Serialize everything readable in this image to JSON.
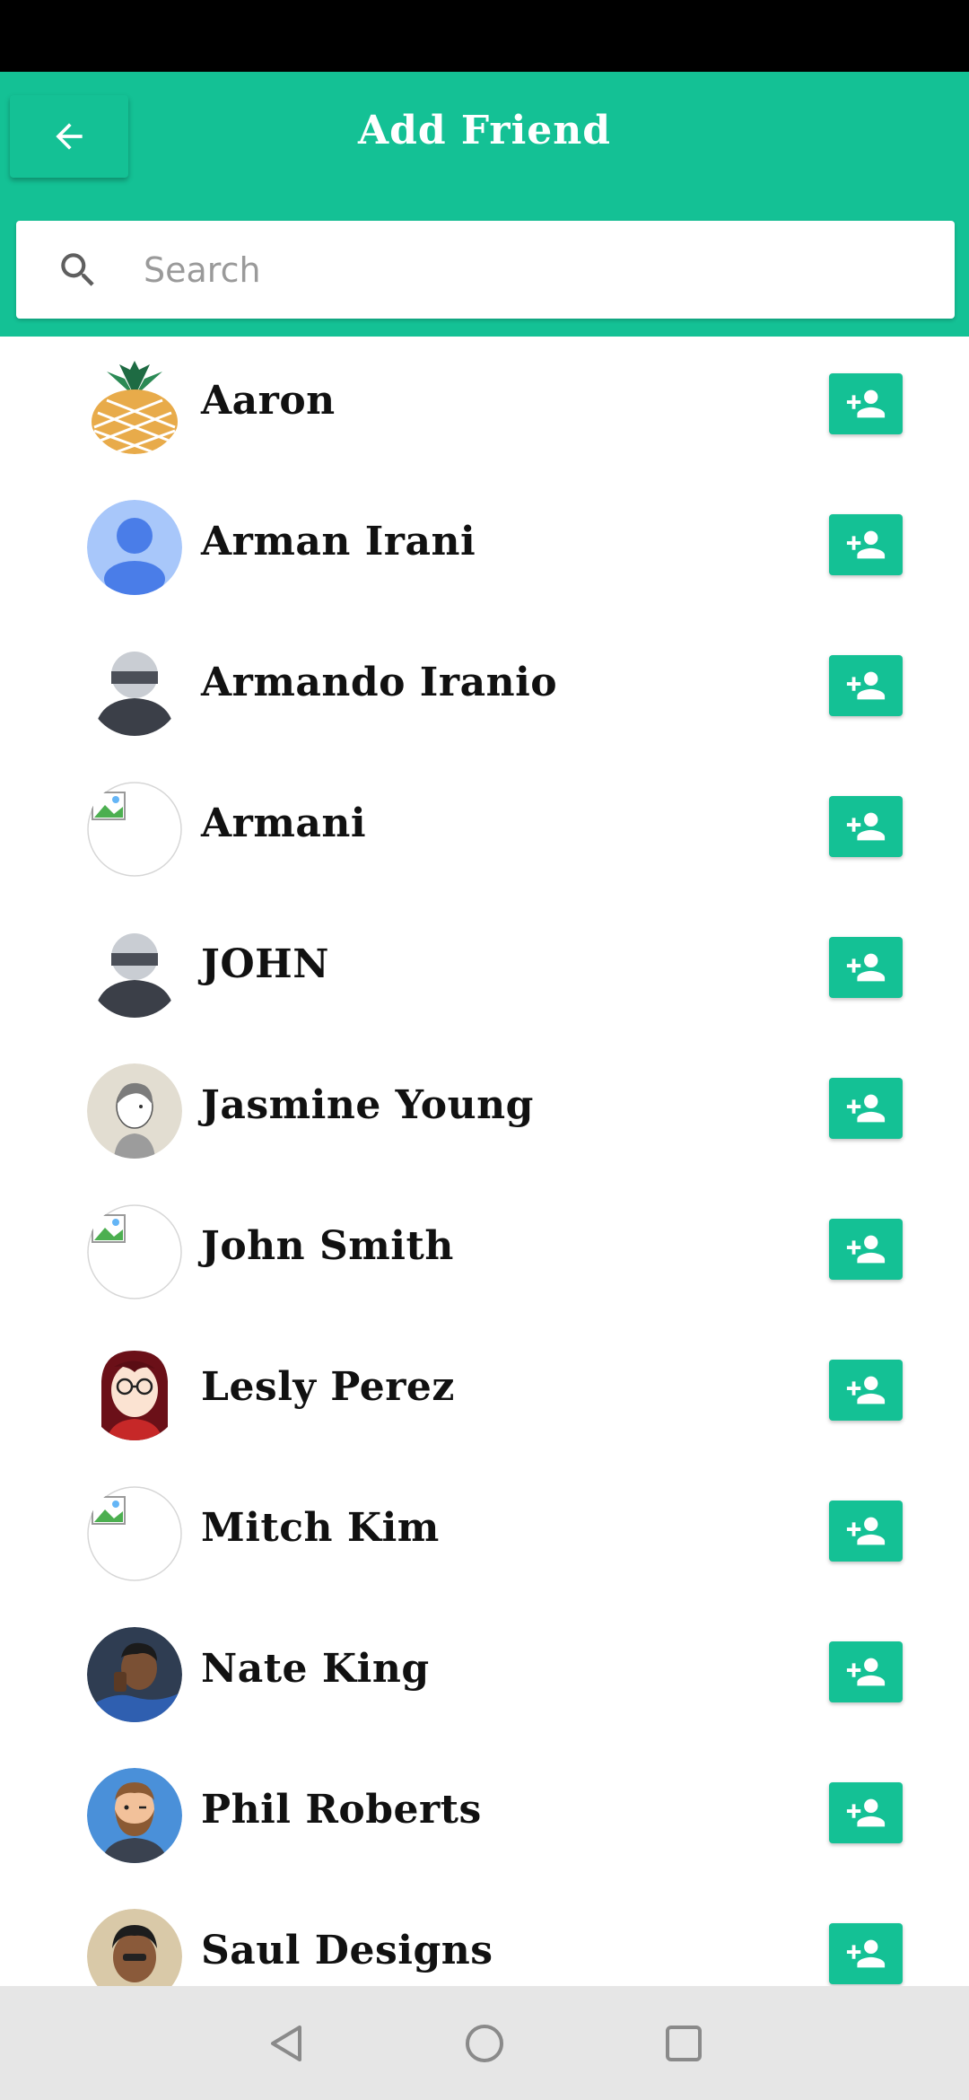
{
  "header": {
    "title": "Add Friend",
    "back_icon": "arrow-left-icon"
  },
  "search": {
    "placeholder": "Search",
    "value": "",
    "icon": "search-icon"
  },
  "colors": {
    "accent": "#14c195",
    "status_bar": "#000000",
    "nav_bar": "#e6e6e6"
  },
  "friends": [
    {
      "name": "Aaron",
      "avatar": "pineapple-avatar",
      "action_icon": "person-add-icon"
    },
    {
      "name": "Arman Irani",
      "avatar": "default-blue-avatar",
      "action_icon": "person-add-icon"
    },
    {
      "name": "Armando Iranio",
      "avatar": "helmet-avatar",
      "action_icon": "person-add-icon"
    },
    {
      "name": "Armani",
      "avatar": "broken-image-avatar",
      "action_icon": "person-add-icon"
    },
    {
      "name": "JOHN",
      "avatar": "helmet-avatar",
      "action_icon": "person-add-icon"
    },
    {
      "name": "Jasmine Young",
      "avatar": "sketch-girl-avatar",
      "action_icon": "person-add-icon"
    },
    {
      "name": "John Smith",
      "avatar": "broken-image-avatar",
      "action_icon": "person-add-icon"
    },
    {
      "name": "Lesly Perez",
      "avatar": "glasses-woman-avatar",
      "action_icon": "person-add-icon"
    },
    {
      "name": "Mitch Kim",
      "avatar": "broken-image-avatar",
      "action_icon": "person-add-icon"
    },
    {
      "name": "Nate King",
      "avatar": "photo-avatar",
      "action_icon": "person-add-icon"
    },
    {
      "name": "Phil Roberts",
      "avatar": "bearded-man-avatar",
      "action_icon": "person-add-icon"
    },
    {
      "name": "Saul Designs",
      "avatar": "photo-avatar",
      "action_icon": "person-add-icon"
    }
  ],
  "navigation": {
    "back": "nav-back-icon",
    "home": "nav-home-icon",
    "recents": "nav-recents-icon"
  }
}
